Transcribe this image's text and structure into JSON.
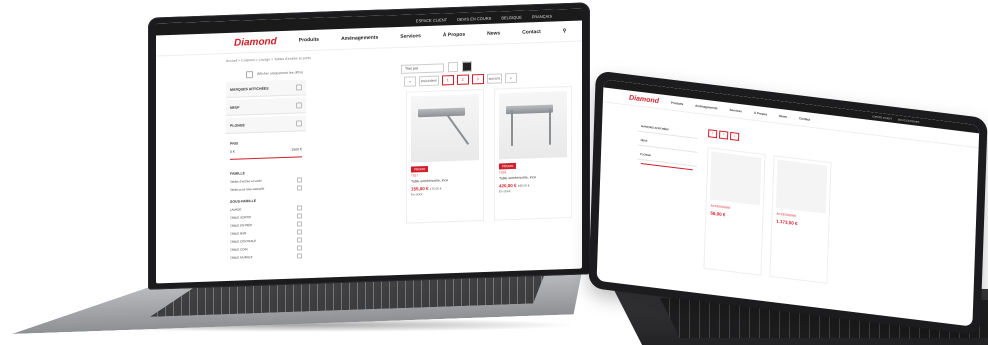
{
  "site": {
    "top_links": [
      "ESPACE CLIENT",
      "DEVIS EN COURS",
      "BELGIQUE",
      "FRANÇAIS"
    ],
    "brand": "Diamond",
    "nav": [
      "Produits",
      "Aménagements",
      "Services",
      "À Propos",
      "News",
      "Contact"
    ],
    "breadcrumb": "Accueil > Cuisines > Lavage > Tables d'entrée et sortie",
    "show_only_checkbox_label": "Afficher uniquement les offres",
    "sort_label": "Trier par",
    "filters": [
      "MARQUES AFFICHÉES",
      "NEUF",
      "PLONGE"
    ],
    "price_filter": {
      "title": "PRIX",
      "min": "0 €",
      "max": "1500 €"
    },
    "family_title": "FAMILLE",
    "family_options": [
      "Tables d'entrée et sortie",
      "Tables pour lave-vaisselle"
    ],
    "subfamily_title": "SOUS-FAMILLE",
    "subfamily_options": [
      "LAVAGE",
      "TABLE SORTIE",
      "TABLE ENTRÉE",
      "TABLE BSR",
      "TABLE CENTRALE",
      "TABLE COIN",
      "TABLE MURALE"
    ],
    "pagination": {
      "prev": "précédent",
      "pages": [
        "1",
        "2",
        "3"
      ],
      "next": "suivant"
    },
    "products": [
      {
        "badge": "PROMO",
        "ref": "TSL7",
        "name": "Table entrée/sortie, inox",
        "price": "155,00 €",
        "old_price": "175,00 €",
        "stock": "En stock"
      },
      {
        "badge": "PROMO",
        "ref": "TSL6",
        "name": "Table entrée/sortie, inox",
        "price": "420,00 €",
        "old_price": "495,00 €",
        "stock": "En stock"
      }
    ]
  },
  "tablet_site": {
    "brand": "Diamond",
    "nav": [
      "Produits",
      "Aménagements",
      "Services",
      "À Propos",
      "News",
      "Contact"
    ],
    "filters": [
      "MARQUES AFFICHÉES",
      "NEUF",
      "PLONGE"
    ],
    "pagination": {
      "pages": [
        "1",
        "2",
        "3"
      ]
    },
    "products": [
      {
        "ref": "ACCESSOIRE",
        "price": "58,00 €"
      },
      {
        "ref": "ACCESSOIRE",
        "price": "1.173,00 €"
      }
    ]
  }
}
